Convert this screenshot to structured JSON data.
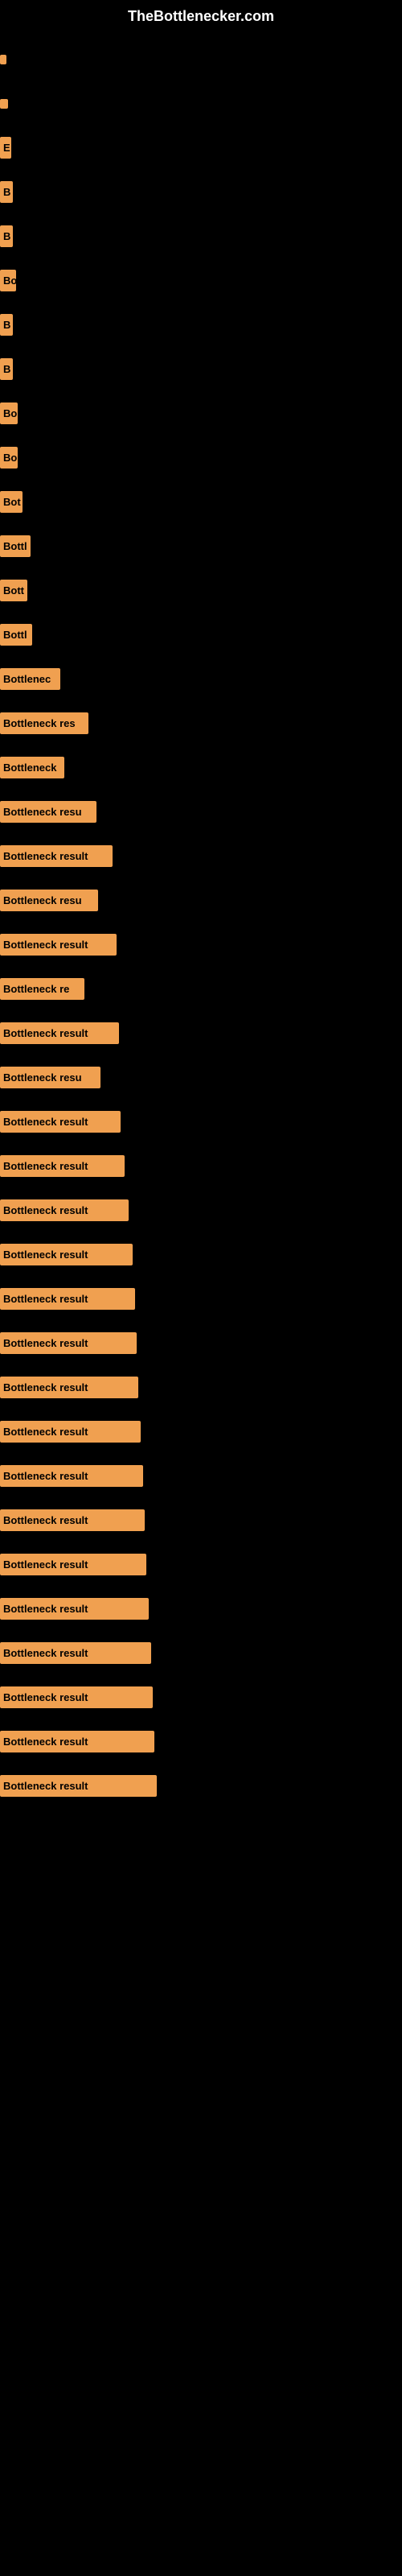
{
  "site": {
    "title": "TheBottlenecker.com"
  },
  "bars": [
    {
      "id": 1,
      "label": "",
      "width": 8
    },
    {
      "id": 2,
      "label": "",
      "width": 10
    },
    {
      "id": 3,
      "label": "E",
      "width": 14
    },
    {
      "id": 4,
      "label": "B",
      "width": 16
    },
    {
      "id": 5,
      "label": "B",
      "width": 16
    },
    {
      "id": 6,
      "label": "Bo",
      "width": 20
    },
    {
      "id": 7,
      "label": "B",
      "width": 16
    },
    {
      "id": 8,
      "label": "B",
      "width": 16
    },
    {
      "id": 9,
      "label": "Bo",
      "width": 22
    },
    {
      "id": 10,
      "label": "Bo",
      "width": 22
    },
    {
      "id": 11,
      "label": "Bot",
      "width": 28
    },
    {
      "id": 12,
      "label": "Bottl",
      "width": 38
    },
    {
      "id": 13,
      "label": "Bott",
      "width": 34
    },
    {
      "id": 14,
      "label": "Bottl",
      "width": 40
    },
    {
      "id": 15,
      "label": "Bottlenec",
      "width": 75
    },
    {
      "id": 16,
      "label": "Bottleneck res",
      "width": 110
    },
    {
      "id": 17,
      "label": "Bottleneck",
      "width": 80
    },
    {
      "id": 18,
      "label": "Bottleneck resu",
      "width": 120
    },
    {
      "id": 19,
      "label": "Bottleneck result",
      "width": 140
    },
    {
      "id": 20,
      "label": "Bottleneck resu",
      "width": 122
    },
    {
      "id": 21,
      "label": "Bottleneck result",
      "width": 145
    },
    {
      "id": 22,
      "label": "Bottleneck re",
      "width": 105
    },
    {
      "id": 23,
      "label": "Bottleneck result",
      "width": 148
    },
    {
      "id": 24,
      "label": "Bottleneck resu",
      "width": 125
    },
    {
      "id": 25,
      "label": "Bottleneck result",
      "width": 150
    },
    {
      "id": 26,
      "label": "Bottleneck result",
      "width": 155
    },
    {
      "id": 27,
      "label": "Bottleneck result",
      "width": 160
    },
    {
      "id": 28,
      "label": "Bottleneck result",
      "width": 165
    },
    {
      "id": 29,
      "label": "Bottleneck result",
      "width": 168
    },
    {
      "id": 30,
      "label": "Bottleneck result",
      "width": 170
    },
    {
      "id": 31,
      "label": "Bottleneck result",
      "width": 172
    },
    {
      "id": 32,
      "label": "Bottleneck result",
      "width": 175
    },
    {
      "id": 33,
      "label": "Bottleneck result",
      "width": 178
    },
    {
      "id": 34,
      "label": "Bottleneck result",
      "width": 180
    },
    {
      "id": 35,
      "label": "Bottleneck result",
      "width": 182
    },
    {
      "id": 36,
      "label": "Bottleneck result",
      "width": 185
    },
    {
      "id": 37,
      "label": "Bottleneck result",
      "width": 188
    },
    {
      "id": 38,
      "label": "Bottleneck result",
      "width": 190
    },
    {
      "id": 39,
      "label": "Bottleneck result",
      "width": 192
    },
    {
      "id": 40,
      "label": "Bottleneck result",
      "width": 195
    }
  ]
}
